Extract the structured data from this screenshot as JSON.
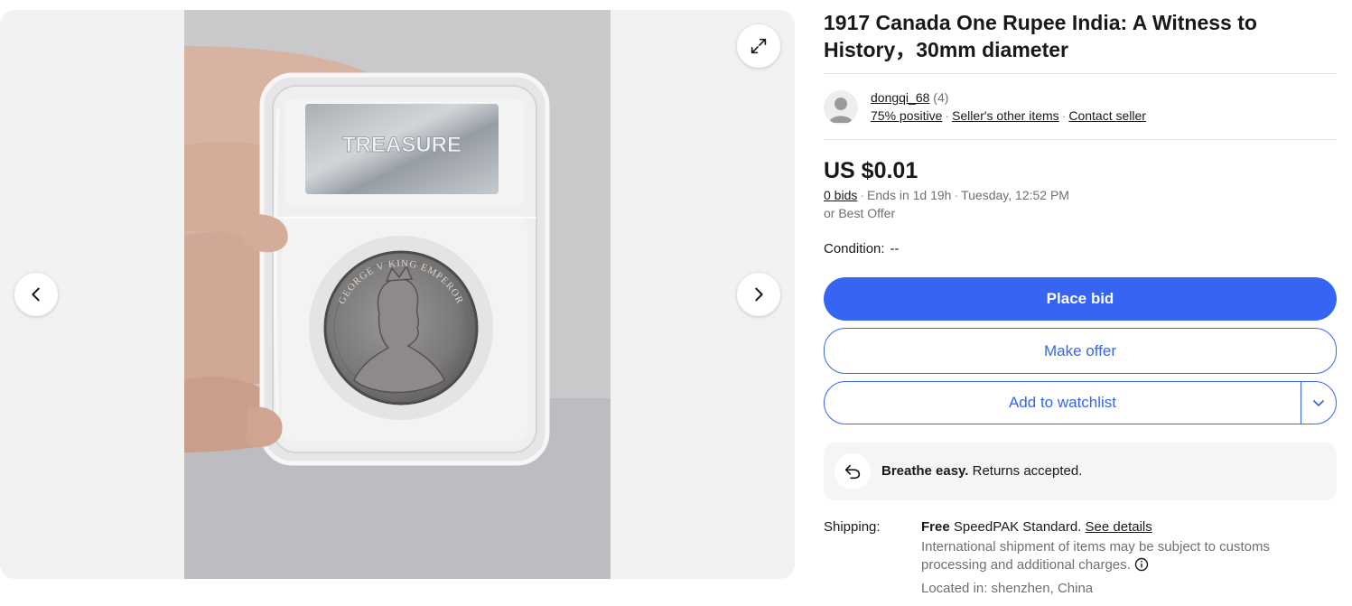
{
  "gallery": {
    "prev_icon": "chevron-left-icon",
    "next_icon": "chevron-right-icon",
    "expand_icon": "expand-icon",
    "slab_label_text": "TREASURE",
    "coin_legend": "GEORGE V KING EMPEROR"
  },
  "listing": {
    "title": "1917 Canada One Rupee India: A Witness to History，30mm diameter"
  },
  "seller": {
    "avatar_icon": "person-icon",
    "username": "dongqi_68",
    "feedback_count": "(4)",
    "positive": "75% positive",
    "other_items": "Seller's other items",
    "contact": "Contact seller"
  },
  "price": {
    "amount": "US $0.01",
    "bids": "0 bids",
    "ends": "Ends in 1d 19h",
    "end_time": "Tuesday, 12:52 PM",
    "best_offer": "or Best Offer"
  },
  "condition": {
    "label": "Condition:",
    "value": "--"
  },
  "actions": {
    "place_bid": "Place bid",
    "make_offer": "Make offer",
    "add_watchlist": "Add to watchlist",
    "watchlist_more_icon": "chevron-down-icon"
  },
  "returns": {
    "icon": "return-arrow-icon",
    "bold": "Breathe easy.",
    "text": "Returns accepted."
  },
  "shipping": {
    "label": "Shipping:",
    "free": "Free",
    "service": "SpeedPAK Standard.",
    "details_link": "See details",
    "note": "International shipment of items may be subject to customs processing and additional charges.",
    "info_icon": "info-icon",
    "location": "Located in: shenzhen, China"
  },
  "colors": {
    "primary_blue": "#3665f3",
    "text": "#191919",
    "muted": "#707070",
    "gallery_bg": "#f2f2f2"
  }
}
